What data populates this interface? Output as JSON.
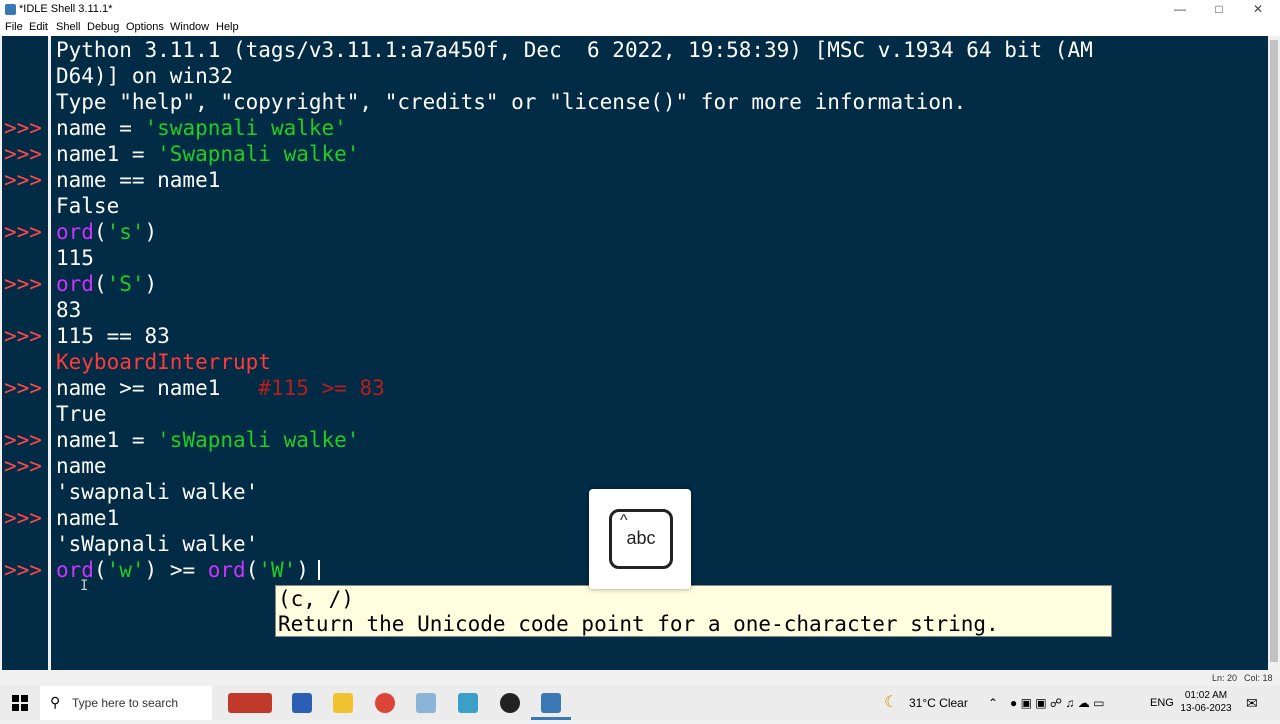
{
  "window": {
    "title": "*IDLE Shell 3.11.1*",
    "controls": [
      "minimize",
      "maximize",
      "close"
    ]
  },
  "menu": [
    "File",
    "Edit",
    "Shell",
    "Debug",
    "Options",
    "Window",
    "Help"
  ],
  "shell": {
    "prompt": ">>>",
    "banner": [
      "Python 3.11.1 (tags/v3.11.1:a7a450f, Dec  6 2022, 19:58:39) [MSC v.1934 64 bit (AM",
      "D64)] on win32",
      "Type \"help\", \"copyright\", \"credits\" or \"license()\" for more information."
    ],
    "lines": [
      {
        "kind": "input",
        "segments": [
          {
            "t": "name = ",
            "c": "white"
          },
          {
            "t": "'swapnali walke'",
            "c": "green"
          }
        ]
      },
      {
        "kind": "input",
        "segments": [
          {
            "t": "name1 = ",
            "c": "white"
          },
          {
            "t": "'Swapnali walke'",
            "c": "green"
          }
        ]
      },
      {
        "kind": "input",
        "segments": [
          {
            "t": "name == name1",
            "c": "white"
          }
        ]
      },
      {
        "kind": "output",
        "segments": [
          {
            "t": "False",
            "c": "white"
          }
        ]
      },
      {
        "kind": "input",
        "segments": [
          {
            "t": "ord",
            "c": "purple"
          },
          {
            "t": "(",
            "c": "white"
          },
          {
            "t": "'s'",
            "c": "green"
          },
          {
            "t": ")",
            "c": "white"
          }
        ]
      },
      {
        "kind": "output",
        "segments": [
          {
            "t": "115",
            "c": "white"
          }
        ]
      },
      {
        "kind": "input",
        "segments": [
          {
            "t": "ord",
            "c": "purple"
          },
          {
            "t": "(",
            "c": "white"
          },
          {
            "t": "'S'",
            "c": "green"
          },
          {
            "t": ")",
            "c": "white"
          }
        ]
      },
      {
        "kind": "output",
        "segments": [
          {
            "t": "83",
            "c": "white"
          }
        ]
      },
      {
        "kind": "input",
        "segments": [
          {
            "t": "115 == 83",
            "c": "white"
          }
        ]
      },
      {
        "kind": "output",
        "segments": [
          {
            "t": "KeyboardInterrupt",
            "c": "red"
          }
        ]
      },
      {
        "kind": "input",
        "segments": [
          {
            "t": "name >= name1   ",
            "c": "white"
          },
          {
            "t": "#115 >= 83",
            "c": "comment"
          }
        ]
      },
      {
        "kind": "output",
        "segments": [
          {
            "t": "True",
            "c": "white"
          }
        ]
      },
      {
        "kind": "input",
        "segments": [
          {
            "t": "name1 = ",
            "c": "white"
          },
          {
            "t": "'sWapnali walke'",
            "c": "green"
          }
        ]
      },
      {
        "kind": "input",
        "segments": [
          {
            "t": "name",
            "c": "white"
          }
        ]
      },
      {
        "kind": "output",
        "segments": [
          {
            "t": "'swapnali walke'",
            "c": "white"
          }
        ]
      },
      {
        "kind": "input",
        "segments": [
          {
            "t": "name1",
            "c": "white"
          }
        ]
      },
      {
        "kind": "output",
        "segments": [
          {
            "t": "'sWapnali walke'",
            "c": "white"
          }
        ]
      },
      {
        "kind": "input",
        "segments": [
          {
            "t": "ord",
            "c": "purple"
          },
          {
            "t": "(",
            "c": "white"
          },
          {
            "t": "'w'",
            "c": "green"
          },
          {
            "t": ") >= ",
            "c": "white"
          },
          {
            "t": "ord",
            "c": "purple"
          },
          {
            "t": "(",
            "c": "white"
          },
          {
            "t": "'W'",
            "c": "green"
          },
          {
            "t": ")",
            "c": "white"
          }
        ]
      }
    ]
  },
  "calltip": {
    "signature": "(c, /)",
    "doc": "Return the Unicode code point for a one-character string."
  },
  "osd": {
    "label": "abc",
    "icon": "caps-lock-icon"
  },
  "status": {
    "line": "Ln: 20",
    "col": "Col: 18"
  },
  "taskbar": {
    "search_placeholder": "Type here to search",
    "weather": "31°C  Clear",
    "lang": "ENG",
    "time": "01:02 AM",
    "date": "13-06-2023"
  },
  "colors": {
    "shell_bg": "#022b45",
    "prompt": "#ff4a4a",
    "string": "#22cc22",
    "builtin": "#cc33ff",
    "error": "#ff3b3b",
    "comment": "#b81e1e"
  }
}
